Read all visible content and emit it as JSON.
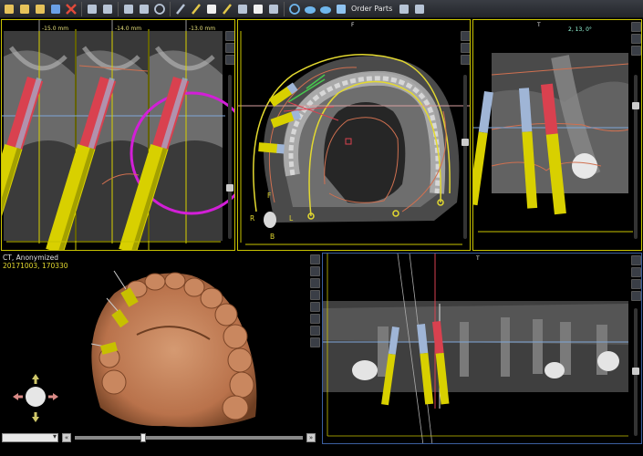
{
  "toolbar": {
    "order_parts_label": "Order Parts",
    "icons": [
      "new-file-icon",
      "open-file-icon",
      "open-folder-icon",
      "save-icon",
      "close-icon",
      "undo-icon",
      "redo-icon",
      "layout-icon",
      "export-icon",
      "zoom-icon",
      "measure-icon",
      "pencil-icon",
      "tooth-icon",
      "implant-icon",
      "ruler-icon",
      "teeth-chart-icon",
      "image-color-icon",
      "rotate-icon",
      "cloud-up-icon",
      "cloud-down-icon",
      "cart-icon",
      "ruler-scale-icon",
      "protractor-icon"
    ]
  },
  "cross_sections": {
    "labels": [
      "-15.0 mm",
      "-14.0 mm",
      "-13.0 mm"
    ]
  },
  "axial": {
    "label_top": "F",
    "orientation": {
      "front": "F",
      "right": "R",
      "left": "L",
      "back": "B"
    }
  },
  "tangential": {
    "readout": "2, 13, 0°",
    "label_top": "T"
  },
  "volume": {
    "patient": "CT, Anonymized",
    "study": "20171003, 170330"
  },
  "panoramic": {
    "label_top": "T"
  },
  "colors": {
    "implant_body": "#d8d000",
    "implant_abutment_red": "#d9414f",
    "implant_abutment_blue": "#9fb5d6",
    "outline": "#c9c300",
    "arch_curve": "#e3d930",
    "axis_magenta": "#d21fd7"
  }
}
